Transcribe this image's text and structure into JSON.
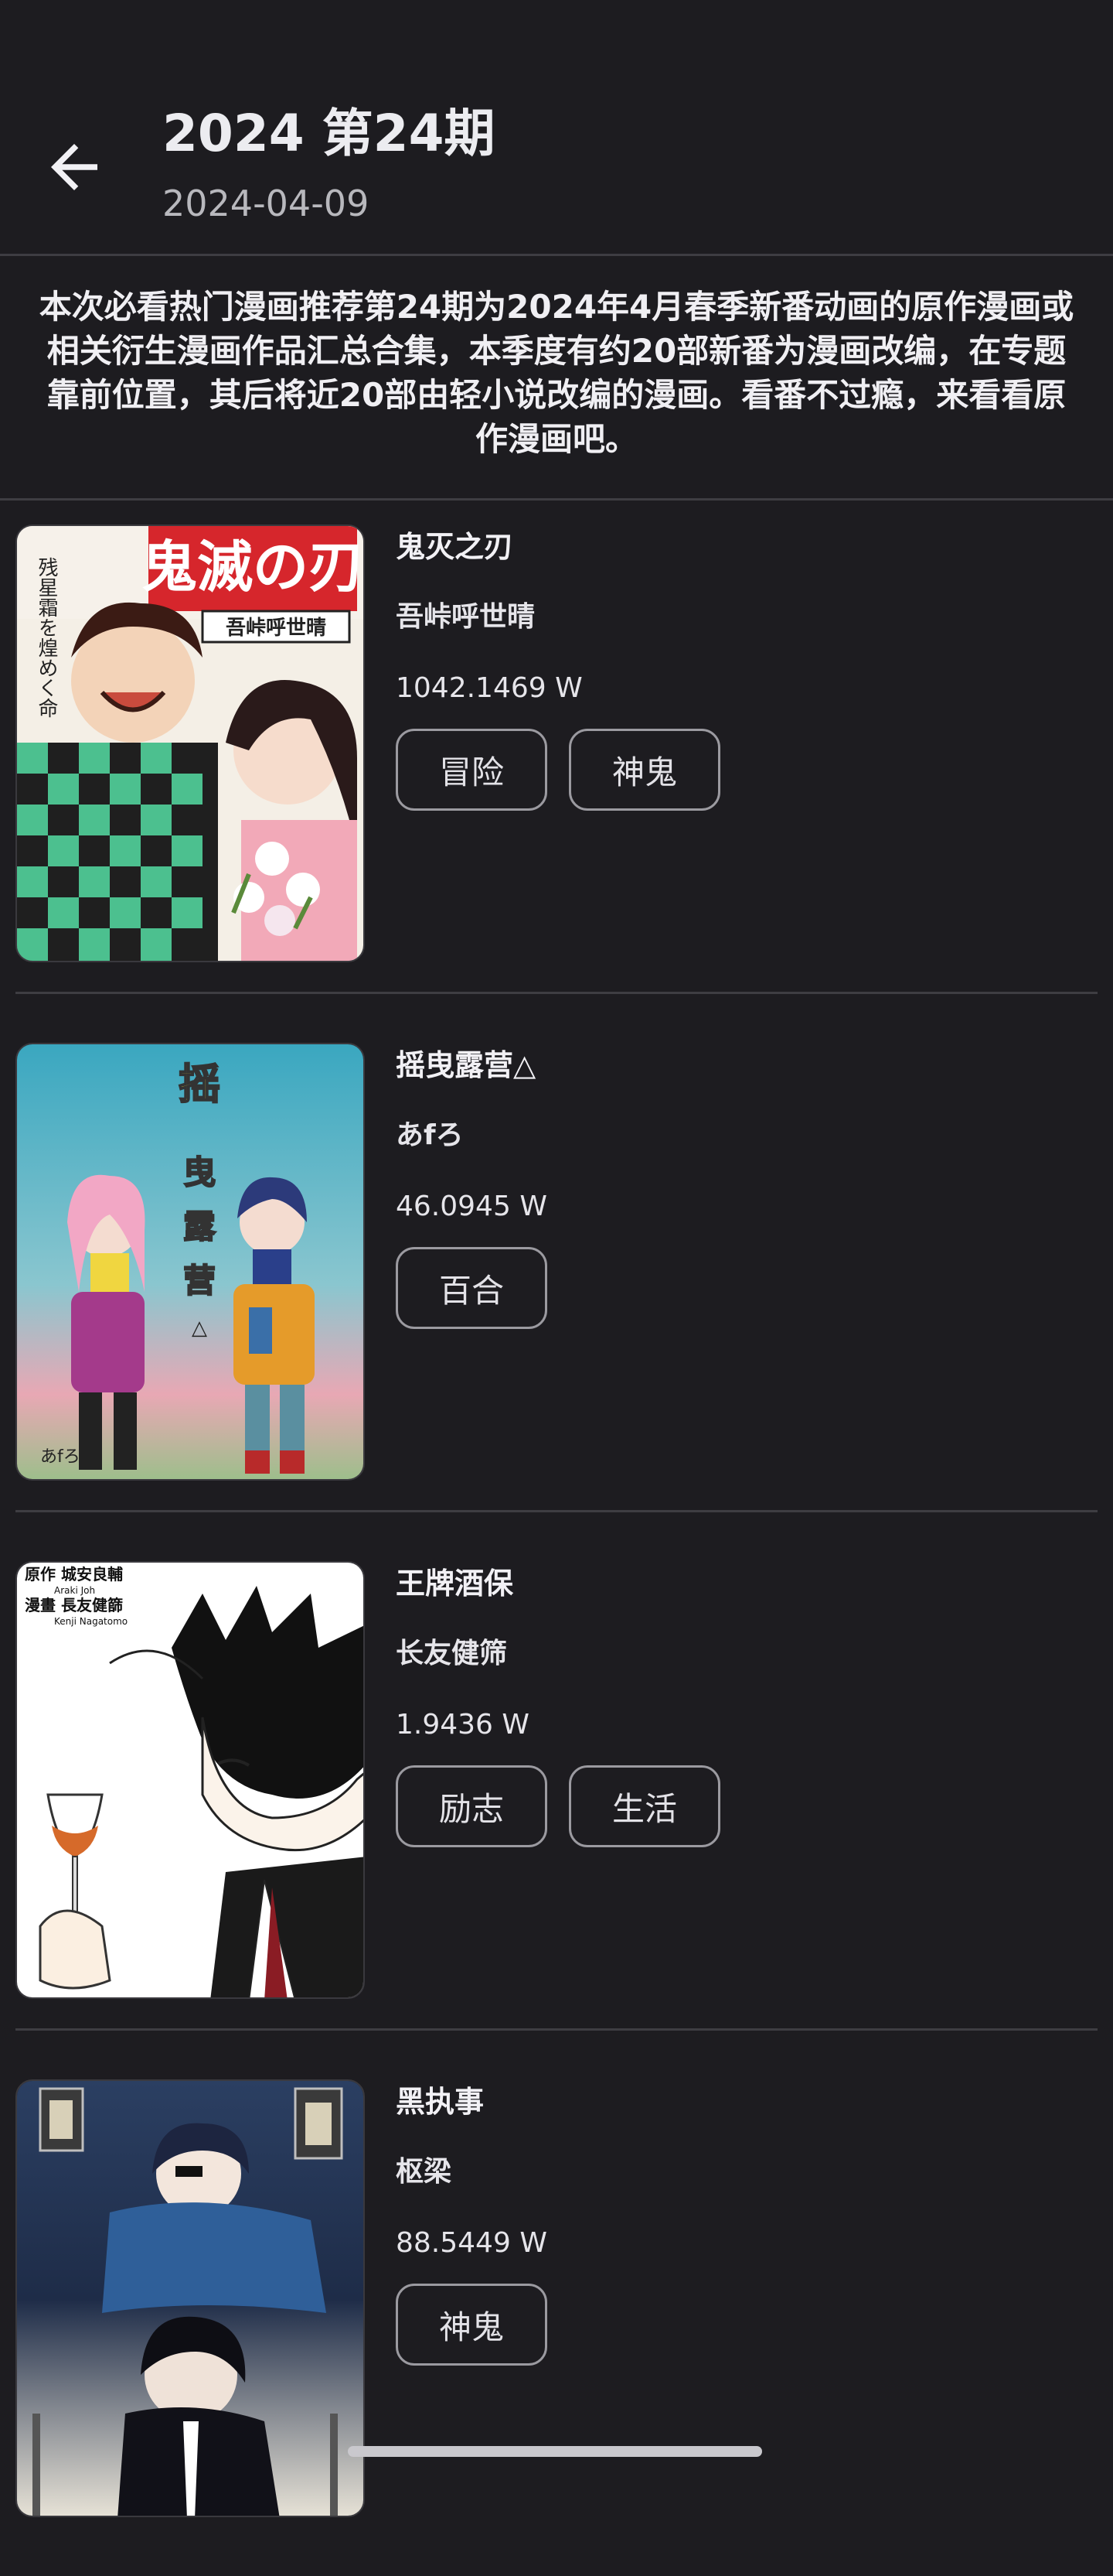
{
  "header": {
    "back_icon": "arrow-left-icon",
    "title": "2024 第24期",
    "date": "2024-04-09"
  },
  "description": "本次必看热门漫画推荐第24期为2024年4月春季新番动画的原作漫画或相关衍生漫画作品汇总合集，本季度有约20部新番为漫画改编，在专题靠前位置，其后将近20部由轻小说改编的漫画。看番不过瘾，来看看原作漫画吧。",
  "items": [
    {
      "title": "鬼灭之刃",
      "author": "吾峠呼世晴",
      "popularity": "1042.1469 W",
      "tags": [
        "冒险",
        "神鬼"
      ],
      "cover_text": "鬼滅の刃",
      "cover_sub": "吾峠呼世晴",
      "cover_side": "残星霜を煌めく命"
    },
    {
      "title": "摇曳露营△",
      "author": "あfろ",
      "popularity": "46.0945 W",
      "tags": [
        "百合"
      ],
      "cover_text": "摇曳露营△",
      "cover_sub": "あfろ"
    },
    {
      "title": "王牌酒保",
      "author": "长友健筛",
      "popularity": "1.9436 W",
      "tags": [
        "励志",
        "生活"
      ],
      "cover_line1": "原作 城安良輔",
      "cover_line1b": "Araki Joh",
      "cover_line2": "漫畫 長友健篩",
      "cover_line2b": "Kenji Nagatomo"
    },
    {
      "title": "黑执事",
      "author": "枢梁",
      "popularity": "88.5449 W",
      "tags": [
        "神鬼"
      ]
    }
  ],
  "colors": {
    "background": "#1d1c20",
    "divider": "#3e3d42",
    "tag_border": "#9b9aa0"
  }
}
